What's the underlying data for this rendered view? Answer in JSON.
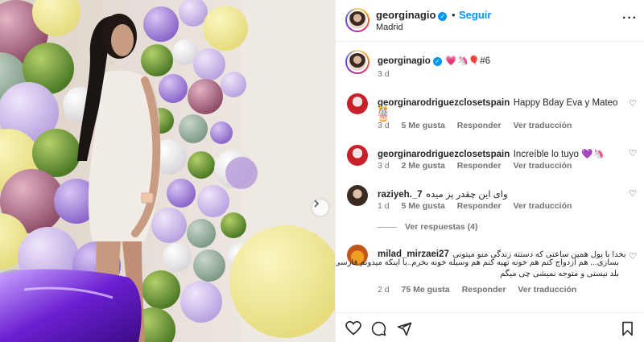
{
  "header": {
    "username": "georginagio",
    "dot": "•",
    "follow_label": "Seguir",
    "location": "Madrid",
    "more_icon": "more-horizontal-icon"
  },
  "caption": {
    "username": "georginagio",
    "text": "💗🦄🎈#6",
    "time": "3 d"
  },
  "comments": [
    {
      "username": "georginarodriguezclosetspain",
      "text": "Happy Bday Eva y Mateo 🎂",
      "text2": "🎊",
      "time": "3 d",
      "likes": "5 Me gusta",
      "reply": "Responder",
      "translate": "Ver traducción"
    },
    {
      "username": "georginarodriguezclosetspain",
      "text": "Increíble lo tuyo 💜🦄",
      "time": "3 d",
      "likes": "2 Me gusta",
      "reply": "Responder",
      "translate": "Ver traducción"
    },
    {
      "username": "raziyeh._7",
      "text": "وای این چقدر پز میده",
      "time": "1 d",
      "likes": "5 Me gusta",
      "reply": "Responder",
      "translate": "Ver traducción",
      "view_replies": "Ver respuestas (4)"
    },
    {
      "username": "milad_mirzaei27",
      "line1": "بخدا با پول همین ساعتی که دستته زندگی منو میتونی",
      "line2": "بسازی... هم ازدواج کنم هم خونه تهیه کنم هم وسیله خونه بخرم..با اینکه میدونم فارسی",
      "line3": "بلد نیستی و متوجه نمیشی چی میگم",
      "time": "2 d",
      "likes": "75 Me gusta",
      "reply": "Responder",
      "translate": "Ver traducción"
    }
  ],
  "icons": {
    "like": "heart-icon",
    "comment": "comment-icon",
    "share": "share-icon",
    "save": "bookmark-icon"
  },
  "colors": {
    "accent": "#0095f6",
    "text": "#262626",
    "muted": "#737373"
  }
}
